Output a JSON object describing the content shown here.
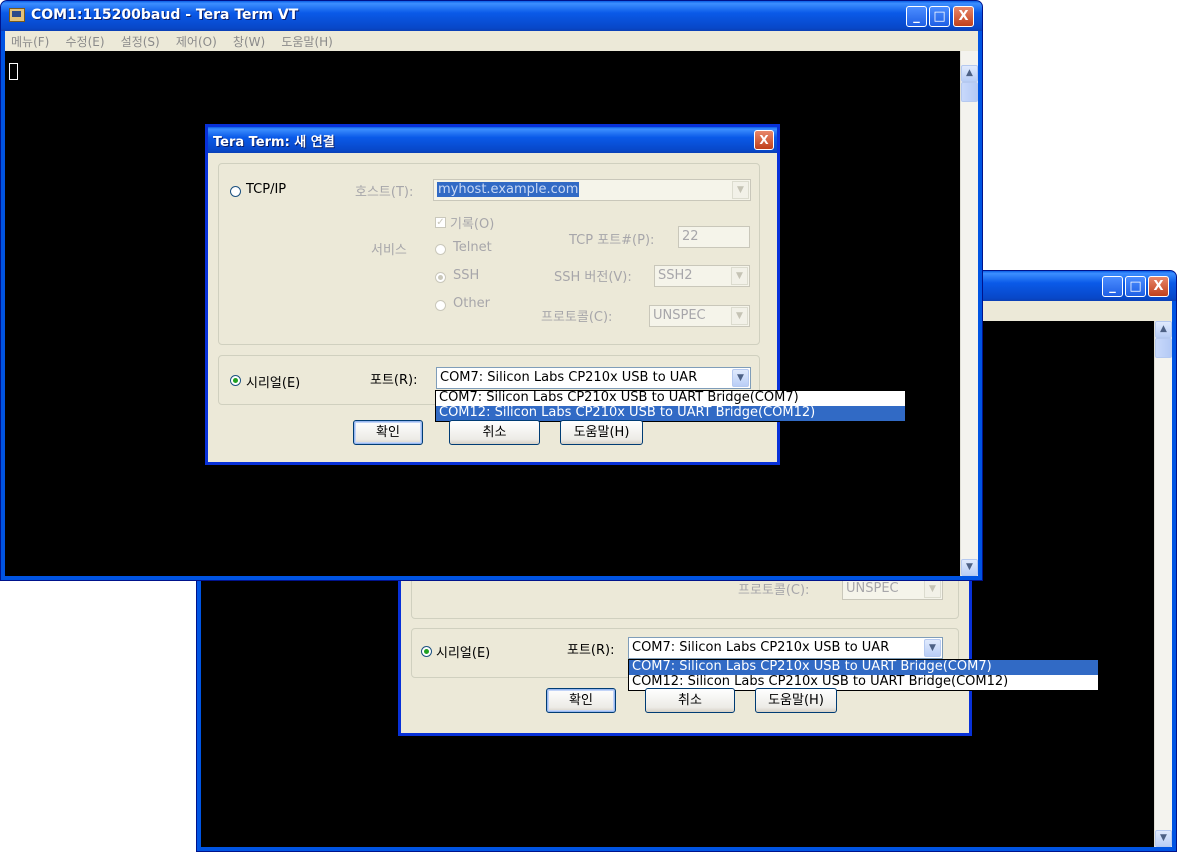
{
  "colors": {
    "titlebar": "#0054e3",
    "terminal_bg": "#000000",
    "dialog_bg": "#ece9d8",
    "selection": "#316ac5"
  },
  "back_window": {
    "buttons": {
      "minimize": "_",
      "maximize": "□",
      "close": "X"
    },
    "scroll_up": "▲",
    "scroll_down": "▼",
    "dialog": {
      "protocol_label": "프로토콜(C):",
      "protocol_value": "UNSPEC",
      "serial_label": "시리얼(E)",
      "port_label": "포트(R):",
      "port_value": "COM7: Silicon Labs CP210x USB to UAR",
      "options": [
        "COM7: Silicon Labs CP210x USB to UART Bridge(COM7)",
        "COM12: Silicon Labs CP210x USB to UART Bridge(COM12)"
      ],
      "ok": "확인",
      "cancel": "취소",
      "help": "도움말(H)"
    }
  },
  "front_window": {
    "title": "COM1:115200baud - Tera Term VT",
    "buttons": {
      "minimize": "_",
      "maximize": "□",
      "close": "X"
    },
    "menu": [
      "메뉴(F)",
      "수정(E)",
      "설정(S)",
      "제어(O)",
      "창(W)",
      "도움말(H)"
    ],
    "scroll_up": "▲",
    "scroll_down": "▼",
    "dialog": {
      "title": "Tera Term: 새 연결",
      "close": "X",
      "tcpip": "TCP/IP",
      "host_label": "호스트(T):",
      "host_value": "myhost.example.com",
      "history": "기록(O)",
      "service_label": "서비스",
      "telnet": "Telnet",
      "tcp_port_label": "TCP 포트#(P):",
      "tcp_port_value": "22",
      "ssh": "SSH",
      "ssh_version_label": "SSH 버전(V):",
      "ssh_version_value": "SSH2",
      "other": "Other",
      "protocol_label": "프로토콜(C):",
      "protocol_value": "UNSPEC",
      "serial_label": "시리얼(E)",
      "port_label": "포트(R):",
      "port_value": "COM7: Silicon Labs CP210x USB to UAR",
      "options": [
        "COM7: Silicon Labs CP210x USB to UART Bridge(COM7)",
        "COM12: Silicon Labs CP210x USB to UART Bridge(COM12)"
      ],
      "ok": "확인",
      "cancel": "취소",
      "help": "도움말(H)"
    }
  }
}
